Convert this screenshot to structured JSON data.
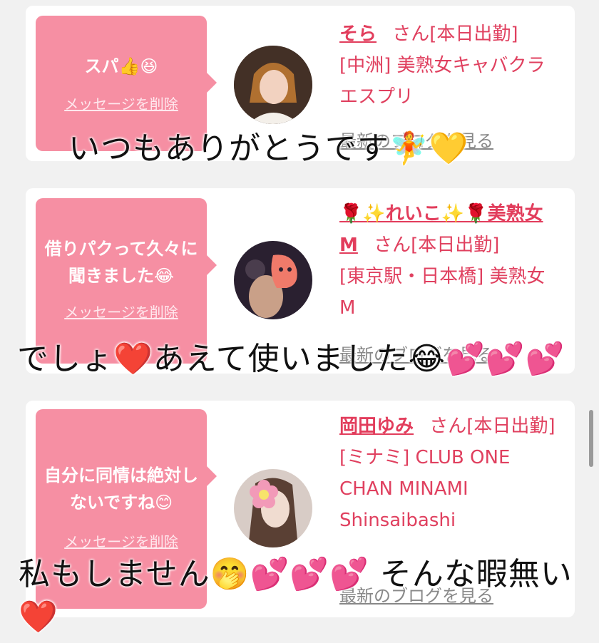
{
  "colors": {
    "accent": "#e0405f",
    "bubble": "#f68fa3"
  },
  "cards": [
    {
      "message": "スパ👍😆",
      "delete_label": "メッセージを削除",
      "name": "そら",
      "suffix": "さん[本日出勤]",
      "shop": "[中洲] 美熟女キャバクラ エスプリ",
      "blog_label": "最新のブログを見る",
      "overlay": "いつもありがとうです🧚💛"
    },
    {
      "message": "借りパクって久々に聞きました😂",
      "delete_label": "メッセージを削除",
      "name": "🌹✨れいこ✨🌹美熟女M",
      "suffix": "さん[本日出勤]",
      "shop": "[東京駅・日本橋] 美熟女 M",
      "blog_label": "最新のブログを見る",
      "overlay": "でしょ❤️あえて使いました😂💕💕💕"
    },
    {
      "message": "自分に同情は絶対しないですね😊",
      "delete_label": "メッセージを削除",
      "name": "岡田ゆみ",
      "suffix": "さん[本日出勤]",
      "shop": "[ミナミ] CLUB ONE CHAN MINAMI Shinsaibashi",
      "blog_label": "最新のブログを見る",
      "overlay": "私もしません🤭💕💕💕 そんな暇無い❤️"
    }
  ]
}
